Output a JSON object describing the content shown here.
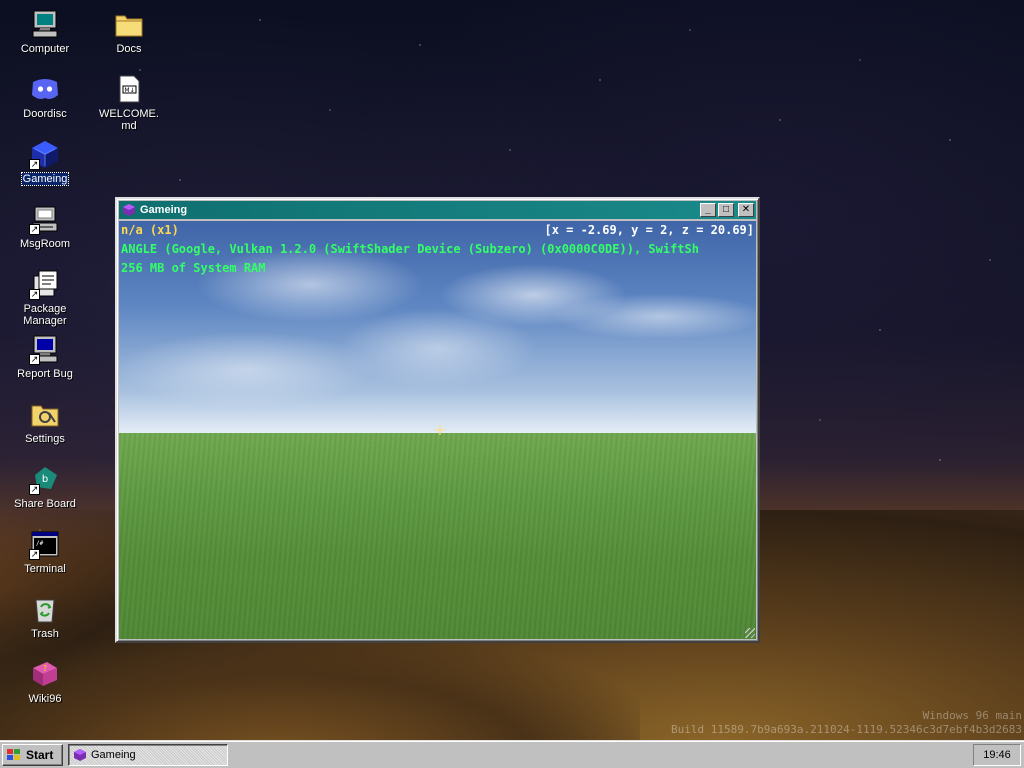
{
  "desktop": {
    "icons": [
      {
        "label": "Computer",
        "icon": "computer-icon"
      },
      {
        "label": "Docs",
        "icon": "folder-icon"
      },
      {
        "label": "Doordisc",
        "icon": "doordisc-icon"
      },
      {
        "label": "WELCOME.md",
        "icon": "markdown-file-icon"
      },
      {
        "label": "Gameing",
        "icon": "gameing-icon",
        "selected": true
      },
      {
        "label": "MsgRoom",
        "icon": "msgroom-icon"
      },
      {
        "label": "Package Manager",
        "icon": "package-manager-icon"
      },
      {
        "label": "Report Bug",
        "icon": "report-bug-icon"
      },
      {
        "label": "Settings",
        "icon": "settings-icon"
      },
      {
        "label": "Share Board",
        "icon": "share-board-icon"
      },
      {
        "label": "Terminal",
        "icon": "terminal-icon"
      },
      {
        "label": "Trash",
        "icon": "trash-icon"
      },
      {
        "label": "Wiki96",
        "icon": "wiki96-icon"
      }
    ],
    "watermark": {
      "line1": "Windows 96 main",
      "line2": "Build 11589.7b9a693a.211024-1119.52346c3d7ebf4b3d2683"
    }
  },
  "window": {
    "title": "Gameing",
    "buttons": {
      "minimize": "_",
      "maximize": "□",
      "close": "✕"
    },
    "hud": {
      "fps": "n/a (x1)",
      "coords": "[x = -2.69, y = 2, z = 20.69]",
      "renderer": "ANGLE (Google, Vulkan 1.2.0 (SwiftShader Device (Subzero) (0x0000C0DE)), SwiftSh",
      "memory": "256 MB of System RAM"
    }
  },
  "taskbar": {
    "start_label": "Start",
    "tasks": [
      {
        "label": "Gameing",
        "active": true
      }
    ],
    "clock": "19:46"
  },
  "colors": {
    "titlebar": "#0f6f6f",
    "hud_yellow": "#ffd94a",
    "hud_green": "#33ff66",
    "selection": "#0a246a"
  }
}
